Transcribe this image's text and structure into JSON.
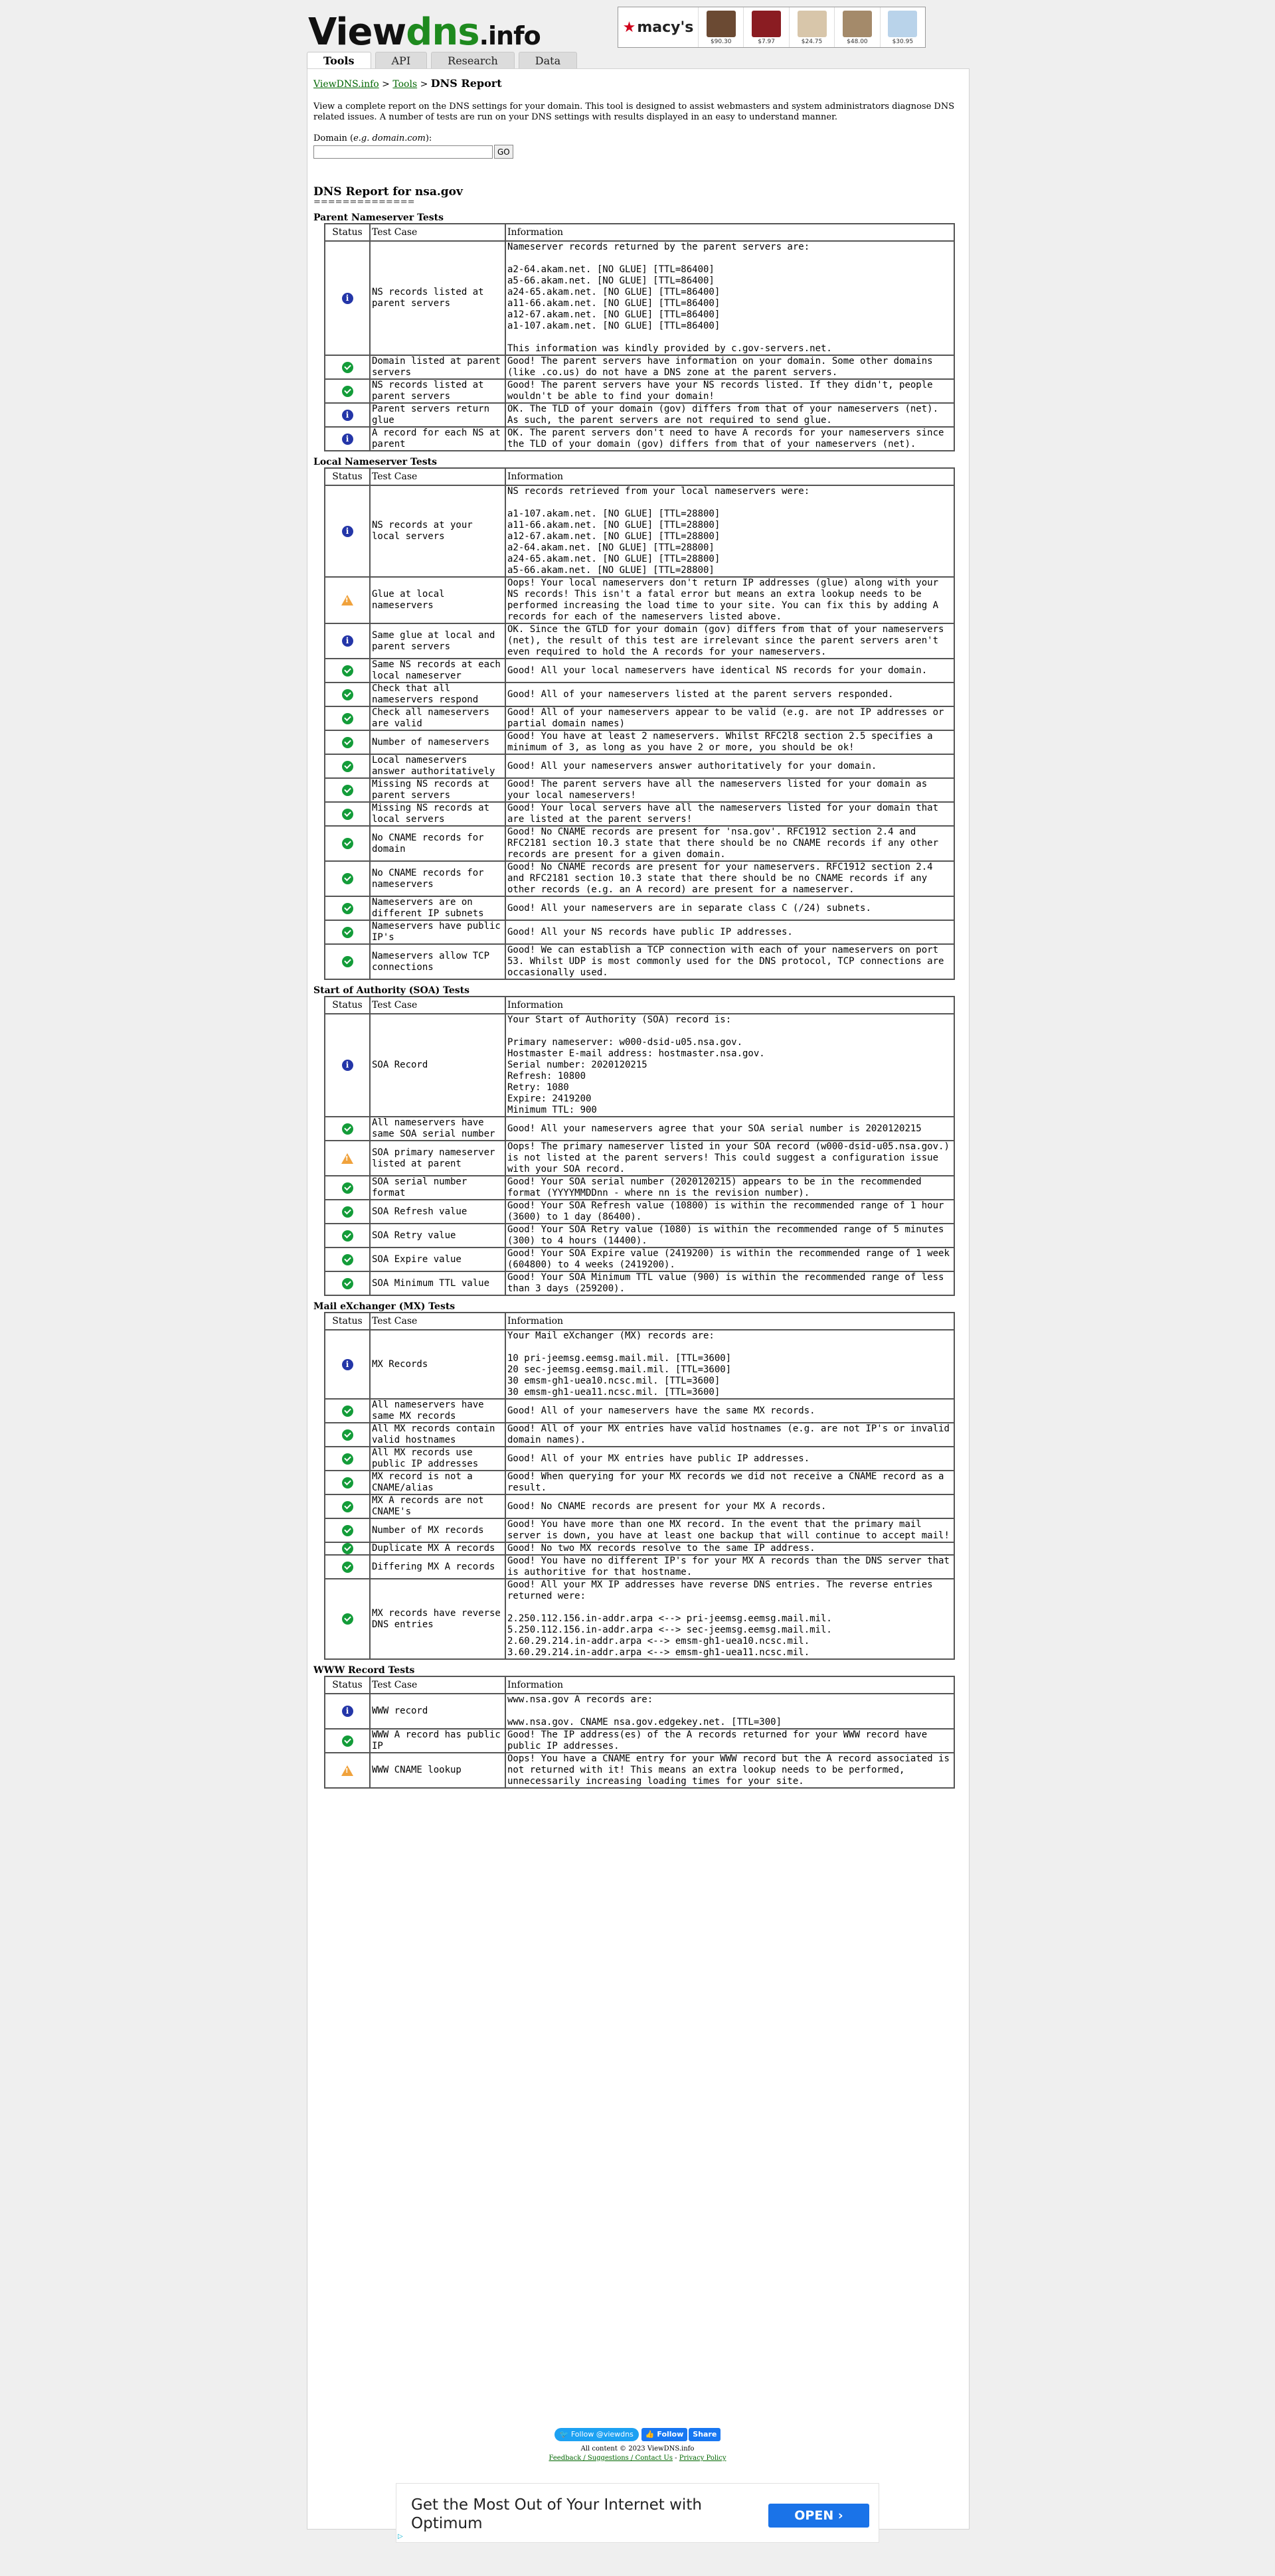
{
  "header": {
    "logo": {
      "view": "View",
      "dns": "dns",
      "info": ".info"
    },
    "ad": {
      "brand": "macy's",
      "items": [
        {
          "price": "$90.30",
          "color": "#6b4a33"
        },
        {
          "price": "$7.97",
          "color": "#8a1c22"
        },
        {
          "price": "$24.75",
          "color": "#d8c6aa"
        },
        {
          "price": "$48.00",
          "color": "#a48a6a"
        },
        {
          "price": "$30.95",
          "color": "#b9d3ea"
        }
      ]
    }
  },
  "tabs": [
    "Tools",
    "API",
    "Research",
    "Data"
  ],
  "breadcrumb": {
    "home": "ViewDNS.info",
    "sep1": " > ",
    "tools": "Tools",
    "sep2": " > ",
    "current": "DNS Report"
  },
  "intro": "View a complete report on the DNS settings for your domain. This tool is designed to assist webmasters and system administrators diagnose DNS related issues. A number of tests are run on your DNS settings with results displayed in an easy to understand manner.",
  "domain_form": {
    "label_prefix": "Domain (",
    "label_example": "e.g. domain.com",
    "label_suffix": "):",
    "value": "",
    "go": "GO"
  },
  "report": {
    "title": "DNS Report for nsa.gov",
    "underline": "=============="
  },
  "columns": {
    "status": "Status",
    "test": "Test Case",
    "info": "Information"
  },
  "sections": [
    {
      "title": "Parent Nameserver Tests",
      "rows": [
        {
          "status": "info",
          "test": "NS records listed at parent servers",
          "info": "Nameserver records returned by the parent servers are:\n\na2-64.akam.net. [NO GLUE] [TTL=86400]\na5-66.akam.net. [NO GLUE] [TTL=86400]\na24-65.akam.net. [NO GLUE] [TTL=86400]\na11-66.akam.net. [NO GLUE] [TTL=86400]\na12-67.akam.net. [NO GLUE] [TTL=86400]\na1-107.akam.net. [NO GLUE] [TTL=86400]\n\nThis information was kindly provided by c.gov-servers.net."
        },
        {
          "status": "good",
          "test": "Domain listed at parent servers",
          "info": "Good! The parent servers have information on your domain. Some other domains (like .co.us) do not have a DNS zone at the parent servers."
        },
        {
          "status": "good",
          "test": "NS records listed at parent servers",
          "info": "Good! The parent servers have your NS records listed. If they didn't, people wouldn't be able to find your domain!"
        },
        {
          "status": "info",
          "test": "Parent servers return glue",
          "info": "OK. The TLD of your domain (gov) differs from that of your nameservers (net). As such, the parent servers are not required to send glue."
        },
        {
          "status": "info",
          "test": "A record for each NS at parent",
          "info": "OK. The parent servers don't need to have A records for your nameservers since the TLD of your domain (gov) differs from that of your nameservers (net)."
        }
      ]
    },
    {
      "title": "Local Nameserver Tests",
      "rows": [
        {
          "status": "info",
          "test": "NS records at your local servers",
          "info": "NS records retrieved from your local nameservers were:\n\na1-107.akam.net. [NO GLUE] [TTL=28800]\na11-66.akam.net. [NO GLUE] [TTL=28800]\na12-67.akam.net. [NO GLUE] [TTL=28800]\na2-64.akam.net. [NO GLUE] [TTL=28800]\na24-65.akam.net. [NO GLUE] [TTL=28800]\na5-66.akam.net. [NO GLUE] [TTL=28800]"
        },
        {
          "status": "warn",
          "test": "Glue at local nameservers",
          "info": "Oops! Your local nameservers don't return IP addresses (glue) along with your NS records! This isn't a fatal error but means an extra lookup needs to be performed increasing the load time to your site. You can fix this by adding A records for each of the nameservers listed above."
        },
        {
          "status": "info",
          "test": "Same glue at local and parent servers",
          "info": "OK. Since the GTLD for your domain (gov) differs from that of your nameservers (net), the result of this test are irrelevant since the parent servers aren't even required to hold the A records for your nameservers."
        },
        {
          "status": "good",
          "test": "Same NS records at each local nameserver",
          "info": "Good! All your local nameservers have identical NS records for your domain."
        },
        {
          "status": "good",
          "test": "Check that all nameservers respond",
          "info": "Good! All of your nameservers listed at the parent servers responded."
        },
        {
          "status": "good",
          "test": "Check all nameservers are valid",
          "info": "Good! All of your nameservers appear to be valid (e.g. are not IP addresses or partial domain names)"
        },
        {
          "status": "good",
          "test": "Number of nameservers",
          "info": "Good! You have at least 2 nameservers. Whilst RFC2l8 section 2.5 specifies a minimum of 3, as long as you have 2 or more, you should be ok!"
        },
        {
          "status": "good",
          "test": "Local nameservers answer authoritatively",
          "info": "Good! All your nameservers answer authoritatively for your domain."
        },
        {
          "status": "good",
          "test": "Missing NS records at parent servers",
          "info": "Good! The parent servers have all the nameservers listed for your domain as your local nameservers!"
        },
        {
          "status": "good",
          "test": "Missing NS records at local servers",
          "info": "Good! Your local servers have all the nameservers listed for your domain that are listed at the parent servers!"
        },
        {
          "status": "good",
          "test": "No CNAME records for domain",
          "info": "Good! No CNAME records are present for 'nsa.gov'. RFC1912 section 2.4 and RFC2181 section 10.3 state that there should be no CNAME records if any other records are present for a given domain."
        },
        {
          "status": "good",
          "test": "No CNAME records for nameservers",
          "info": "Good! No CNAME records are present for your nameservers. RFC1912 section 2.4 and RFC2181 section 10.3 state that there should be no CNAME records if any other records (e.g. an A record) are present for a nameserver."
        },
        {
          "status": "good",
          "test": "Nameservers are on different IP subnets",
          "info": "Good! All your nameservers are in separate class C (/24) subnets."
        },
        {
          "status": "good",
          "test": "Nameservers have public IP's",
          "info": "Good! All your NS records have public IP addresses."
        },
        {
          "status": "good",
          "test": "Nameservers allow TCP connections",
          "info": "Good! We can establish a TCP connection with each of your nameservers on port 53. Whilst UDP is most commonly used for the DNS protocol, TCP connections are occasionally used."
        }
      ]
    },
    {
      "title": "Start of Authority (SOA) Tests",
      "rows": [
        {
          "status": "info",
          "test": "SOA Record",
          "info": "Your Start of Authority (SOA) record is:\n\nPrimary nameserver: w000-dsid-u05.nsa.gov.\nHostmaster E-mail address: hostmaster.nsa.gov.\nSerial number: 2020120215\nRefresh: 10800\nRetry: 1080\nExpire: 2419200\nMinimum TTL: 900"
        },
        {
          "status": "good",
          "test": "All nameservers have same SOA serial number",
          "info": "Good! All your nameservers agree that your SOA serial number is 2020120215"
        },
        {
          "status": "warn",
          "test": "SOA primary nameserver listed at parent",
          "info": "Oops! The primary nameserver listed in your SOA record (w000-dsid-u05.nsa.gov.) is not listed at the parent servers! This could suggest a configuration issue with your SOA record."
        },
        {
          "status": "good",
          "test": "SOA serial number format",
          "info": "Good! Your SOA serial number (2020120215) appears to be in the recommended format (YYYYMMDDnn - where nn is the revision number)."
        },
        {
          "status": "good",
          "test": "SOA Refresh value",
          "info": "Good! Your SOA Refresh value (10800) is within the recommended range of 1 hour (3600) to 1 day (86400)."
        },
        {
          "status": "good",
          "test": "SOA Retry value",
          "info": "Good! Your SOA Retry value (1080) is within the recommended range of 5 minutes (300) to 4 hours (14400)."
        },
        {
          "status": "good",
          "test": "SOA Expire value",
          "info": "Good! Your SOA Expire value (2419200) is within the recommended range of 1 week (604800) to 4 weeks (2419200)."
        },
        {
          "status": "good",
          "test": "SOA Minimum TTL value",
          "info": "Good! Your SOA Minimum TTL value (900) is within the recommended range of less than 3 days (259200)."
        }
      ]
    },
    {
      "title": "Mail eXchanger (MX) Tests",
      "rows": [
        {
          "status": "info",
          "test": "MX Records",
          "info": "Your Mail eXchanger (MX) records are:\n\n10 pri-jeemsg.eemsg.mail.mil. [TTL=3600]\n20 sec-jeemsg.eemsg.mail.mil. [TTL=3600]\n30 emsm-gh1-uea10.ncsc.mil. [TTL=3600]\n30 emsm-gh1-uea11.ncsc.mil. [TTL=3600]"
        },
        {
          "status": "good",
          "test": "All nameservers have same MX records",
          "info": "Good! All of your nameservers have the same MX records."
        },
        {
          "status": "good",
          "test": "All MX records contain valid hostnames",
          "info": "Good! All of your MX entries have valid hostnames (e.g. are not IP's or invalid domain names)."
        },
        {
          "status": "good",
          "test": "All MX records use public IP addresses",
          "info": "Good! All of your MX entries have public IP addresses."
        },
        {
          "status": "good",
          "test": "MX record is not a CNAME/alias",
          "info": "Good! When querying for your MX records we did not receive a CNAME record as a result."
        },
        {
          "status": "good",
          "test": "MX A records are not CNAME's",
          "info": "Good! No CNAME records are present for your MX A records."
        },
        {
          "status": "good",
          "test": "Number of MX records",
          "info": "Good! You have more than one MX record. In the event that the primary mail server is down, you have at least one backup that will continue to accept mail!"
        },
        {
          "status": "good",
          "test": "Duplicate MX A records",
          "info": "Good! No two MX records resolve to the same IP address."
        },
        {
          "status": "good",
          "test": "Differing MX A records",
          "info": "Good! You have no different IP's for your MX A records than the DNS server that is authoritive for that hostname."
        },
        {
          "status": "good",
          "test": "MX records have reverse DNS entries",
          "info": "Good! All your MX IP addresses have reverse DNS entries. The reverse entries returned were:\n\n2.250.112.156.in-addr.arpa <--> pri-jeemsg.eemsg.mail.mil.\n5.250.112.156.in-addr.arpa <--> sec-jeemsg.eemsg.mail.mil.\n2.60.29.214.in-addr.arpa <--> emsm-gh1-uea10.ncsc.mil.\n3.60.29.214.in-addr.arpa <--> emsm-gh1-uea11.ncsc.mil."
        }
      ]
    },
    {
      "title": "WWW Record Tests",
      "rows": [
        {
          "status": "info",
          "test": "WWW record",
          "info": "www.nsa.gov A records are:\n\nwww.nsa.gov. CNAME nsa.gov.edgekey.net. [TTL=300]"
        },
        {
          "status": "good",
          "test": "WWW A record has public IP",
          "info": "Good! The IP address(es) of the A records returned for your WWW record have public IP addresses."
        },
        {
          "status": "warn",
          "test": "WWW CNAME lookup",
          "info": "Oops! You have a CNAME entry for your WWW record but the A record associated is not returned with it! This means an extra lookup needs to be performed, unnecessarily increasing loading times for your site."
        }
      ]
    }
  ],
  "footer": {
    "twitter": "Follow @viewdns",
    "fb_follow": "Follow",
    "fb_share": "Share",
    "copyright": "All content © 2023 ViewDNS.info",
    "links": [
      "Feedback / Suggestions / Contact Us",
      "Privacy Policy"
    ],
    "links_sep": " - "
  },
  "bottom_ad": {
    "text": "Get the Most Out of Your Internet with Optimum",
    "button": "OPEN",
    "button_icon": "chevron-right-icon",
    "button_color": "#1a73e8"
  }
}
